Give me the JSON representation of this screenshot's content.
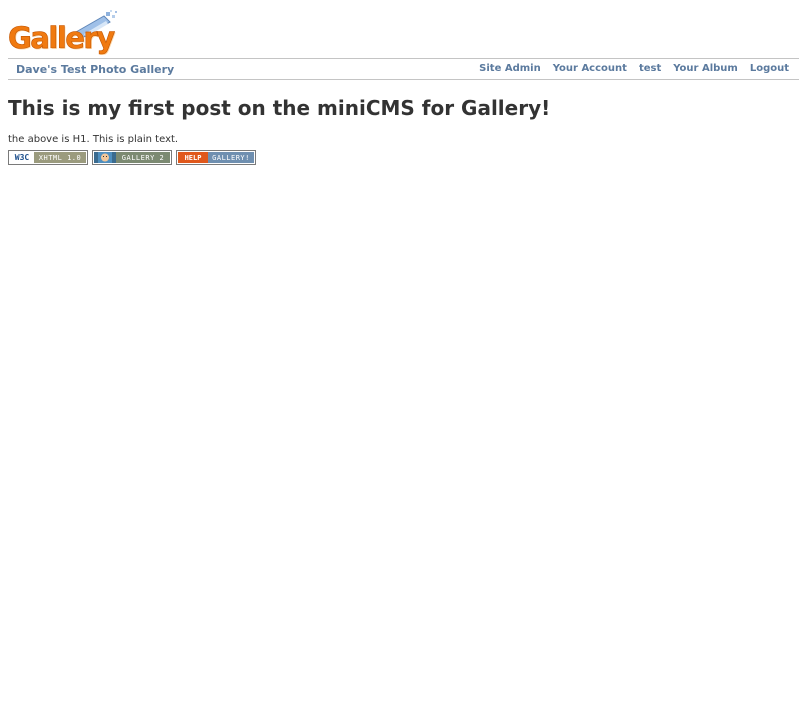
{
  "logo": {
    "text": "Gallery"
  },
  "navbar": {
    "site_title": "Dave's Test Photo Gallery",
    "links": [
      "Site Admin",
      "Your Account",
      "test",
      "Your Album",
      "Logout"
    ]
  },
  "content": {
    "heading": "This is my first post on the miniCMS for Gallery!",
    "body_text": "the above is H1. This is plain text."
  },
  "badges": [
    {
      "left": "W3C",
      "right": "XHTML 1.0",
      "left_color": "#ffffff",
      "right_color": "#9b9b7e"
    },
    {
      "left": "",
      "right": "GALLERY 2",
      "left_color": "#3b6b8f",
      "right_color": "#7c8a72"
    },
    {
      "left": "HELP",
      "right": "GALLERY!",
      "left_color": "#e0581c",
      "right_color": "#6f8fb0"
    }
  ],
  "colors": {
    "link": "#5b7a9e",
    "text": "#333333",
    "logo_orange": "#f07a10"
  },
  "icons": [
    "gallery-logo-icon",
    "w3c-icon",
    "gallery2-face-icon"
  ]
}
